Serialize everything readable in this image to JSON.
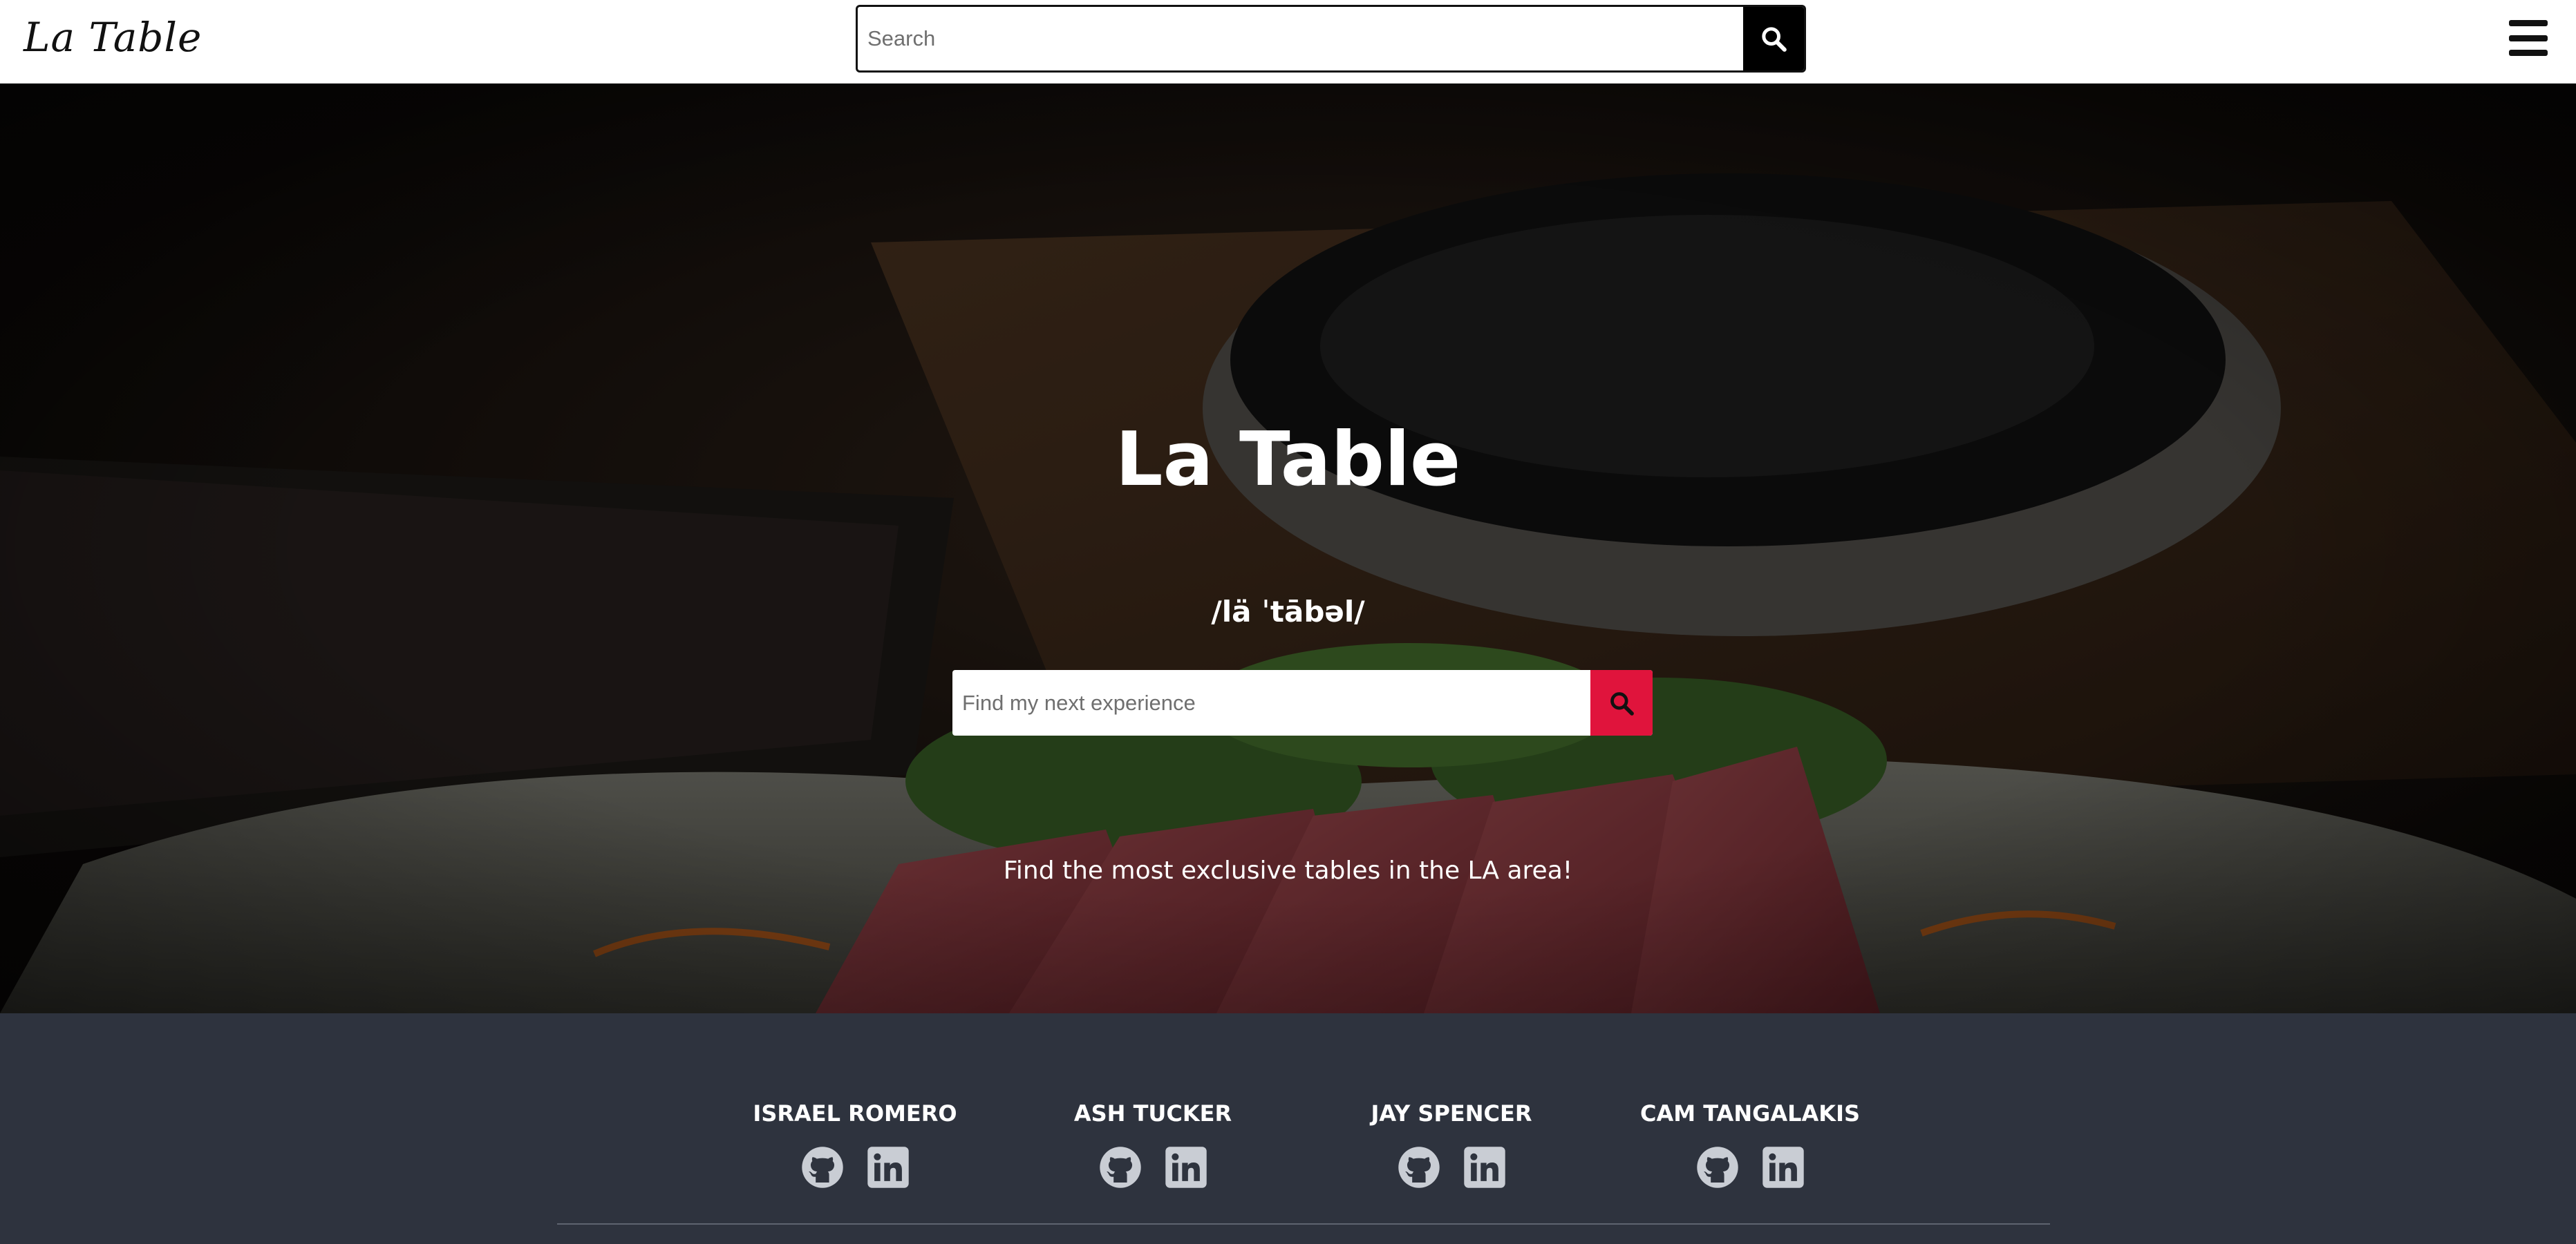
{
  "header": {
    "logo": "La Table",
    "search_placeholder": "Search",
    "search_button_icon": "search-icon",
    "menu_icon": "hamburger-menu-icon"
  },
  "hero": {
    "title": "La Table",
    "phonetic": "/lä ˈtābəl/",
    "search_placeholder": "Find my next experience",
    "search_button_icon": "search-icon",
    "search_button_color": "#e0143c",
    "tagline": "Find the most exclusive tables in the LA area!"
  },
  "footer": {
    "background_color": "#2e333e",
    "team": [
      {
        "name": "ISRAEL ROMERO",
        "icons": [
          "github-icon",
          "linkedin-icon"
        ]
      },
      {
        "name": "ASH TUCKER",
        "icons": [
          "github-icon",
          "linkedin-icon"
        ]
      },
      {
        "name": "JAY SPENCER",
        "icons": [
          "github-icon",
          "linkedin-icon"
        ]
      },
      {
        "name": "CAM TANGALAKIS",
        "icons": [
          "github-icon",
          "linkedin-icon"
        ]
      }
    ]
  }
}
